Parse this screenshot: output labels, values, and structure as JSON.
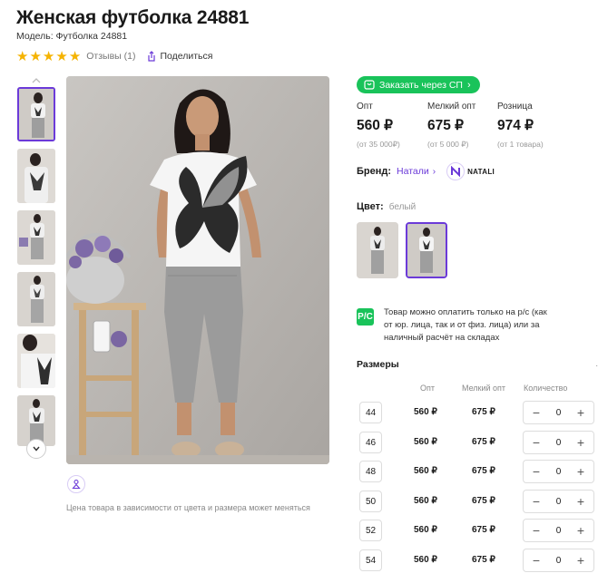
{
  "product": {
    "title": "Женская футболка 24881",
    "model": "Модель: Футболка 24881",
    "rating_stars": 5,
    "reviews": "Отзывы (1)",
    "share": "Поделиться"
  },
  "gallery": {
    "thumbnail_count": 6,
    "active_index": 0,
    "price_note": "Цена товара в зависимости от цвета и размера может меняться"
  },
  "order": {
    "sp_button": "Заказать через СП",
    "prices": [
      {
        "label": "Опт",
        "value": "560 ₽",
        "min": "(от 35 000₽)"
      },
      {
        "label": "Мелкий опт",
        "value": "675 ₽",
        "min": "(от 5 000 ₽)"
      },
      {
        "label": "Розница",
        "value": "974 ₽",
        "min": "(от 1 товара)"
      }
    ],
    "brand_label": "Бренд:",
    "brand_name": "Натали",
    "brand_logo_text": "NATALI",
    "color_label": "Цвет:",
    "color_value": "белый",
    "pay_icon_text": "P/C",
    "pay_note": "Товар можно оплатить только на р/с (как от юр. лица, так и от физ. лица) или за наличный расчёт на складах"
  },
  "sizes": {
    "title": "Размеры",
    "headers": {
      "opt": "Опт",
      "small": "Мелкий опт",
      "qty": "Количество"
    },
    "rows": [
      {
        "size": "44",
        "opt": "560 ₽",
        "small": "675 ₽",
        "qty": "0"
      },
      {
        "size": "46",
        "opt": "560 ₽",
        "small": "675 ₽",
        "qty": "0"
      },
      {
        "size": "48",
        "opt": "560 ₽",
        "small": "675 ₽",
        "qty": "0"
      },
      {
        "size": "50",
        "opt": "560 ₽",
        "small": "675 ₽",
        "qty": "0"
      },
      {
        "size": "52",
        "opt": "560 ₽",
        "small": "675 ₽",
        "qty": "0"
      },
      {
        "size": "54",
        "opt": "560 ₽",
        "small": "675 ₽",
        "qty": "0"
      }
    ]
  },
  "colors": {
    "accent": "#6b3ad8",
    "green": "#19c35a",
    "star": "#f5b301"
  }
}
